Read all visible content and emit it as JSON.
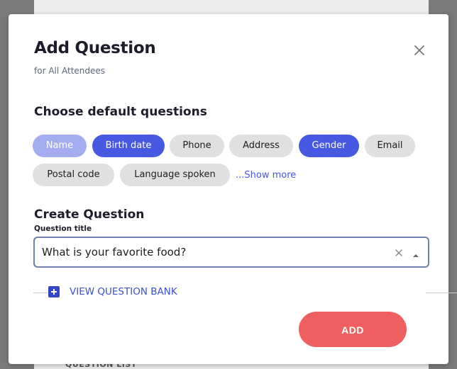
{
  "modal": {
    "title": "Add Question",
    "subtitle": "for All Attendees",
    "default_section_title": "Choose default questions",
    "chips": [
      {
        "label": "Name",
        "state": "disabled"
      },
      {
        "label": "Birth date",
        "state": "selected"
      },
      {
        "label": "Phone",
        "state": "unselected"
      },
      {
        "label": "Address",
        "state": "unselected"
      },
      {
        "label": "Gender",
        "state": "selected"
      },
      {
        "label": "Email",
        "state": "unselected"
      },
      {
        "label": "Postal code",
        "state": "unselected"
      },
      {
        "label": "Language spoken",
        "state": "unselected"
      }
    ],
    "show_more_label": "...Show more",
    "create_section_title": "Create Question",
    "question_title_label": "Question title",
    "question_title_value": "What is your favorite food?",
    "question_bank_label": "VIEW QUESTION BANK",
    "add_button_label": "ADD"
  },
  "background": {
    "footer_label": "QUESTION LIST"
  },
  "colors": {
    "accent": "#4758e3",
    "accent_muted": "#a4acf0",
    "chip_unselected": "#e0e0e0",
    "add_button": "#ef5f5f",
    "link": "#3d4fd6"
  },
  "icons": {
    "close": "close-icon",
    "clear": "clear-icon",
    "dropdown": "caret-up-icon",
    "add": "plus-icon"
  }
}
